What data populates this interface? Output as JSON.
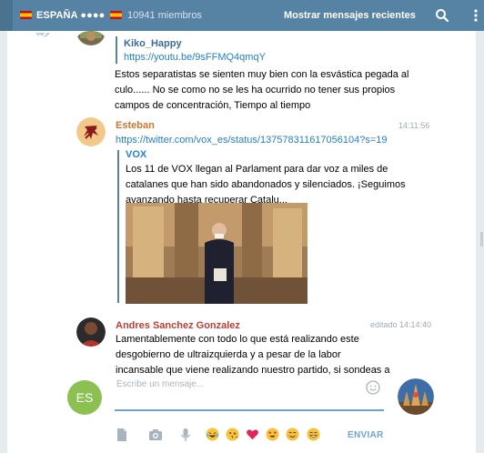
{
  "header": {
    "title": "ESPAÑA ●●●●",
    "members": "10941 miembros",
    "recent_button": "Mostrar mensajes recientes"
  },
  "messages": [
    {
      "author": "Kiko_Happy",
      "link": "https://youtu.be/9sFFMQ4qmqY",
      "lines": [
        "Estos separatistas se sienten muy bien con la esvástica pegada al",
        "culo......     No se como no se les ha ocurrido no tener sus propios",
        "campos de concentración,           Tiempo al tiempo"
      ]
    },
    {
      "author": "Esteban",
      "time": "14:11:56",
      "link": "https://twitter.com/vox_es/status/137578311617056104?s=19",
      "preview": {
        "source": "VOX",
        "lines": [
          "Los 11 de VOX llegan al Parlament para dar voz a miles de",
          "catalanes que han sido abandonados y silenciados. ¡Seguimos",
          "avanzando hasta recuperar Catalu..."
        ]
      }
    },
    {
      "author": "Andres Sanchez Gonzalez",
      "time": "editado 14:14:40",
      "lines": [
        "Lamentablemente con todo lo que está realizando este",
        "desgobierno de ultraizquierda  y a pesar de la labor",
        "incansable que viene realizando nuestro partido, si sondeas a"
      ]
    }
  ],
  "composer": {
    "avatar_initials": "ES",
    "placeholder": "Escribe un mensaje...",
    "send_label": "ENVIAR"
  },
  "colors": {
    "header": "#5682a3",
    "accent": "#2481cc",
    "kiko_name": "#3a6d99",
    "esteban_name": "#d0742f",
    "andres_name": "#c03d33"
  },
  "icons": [
    "flag-spain-icon",
    "search-icon",
    "menu-icon",
    "read-check-icon",
    "emoji-icon",
    "file-icon",
    "camera-icon",
    "microphone-icon"
  ]
}
